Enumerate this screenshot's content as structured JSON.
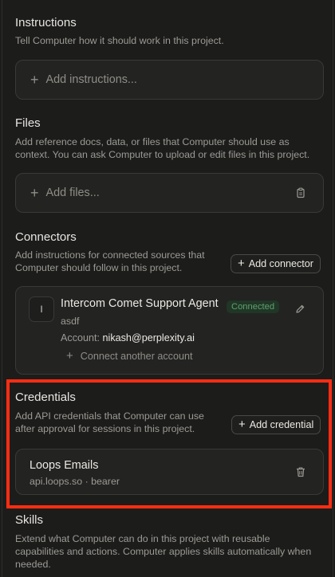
{
  "instructions": {
    "title": "Instructions",
    "description": "Tell Computer how it should work in this project.",
    "add_label": "Add instructions..."
  },
  "files": {
    "title": "Files",
    "description_line1": "Add reference docs, data, or files that Computer should use as",
    "description_line2": "context. You can ask Computer to upload or edit files in this project.",
    "add_label": "Add files..."
  },
  "connectors": {
    "title": "Connectors",
    "description_line1": "Add instructions for connected sources that",
    "description_line2": "Computer should follow in this project.",
    "add_button": "Add connector",
    "card": {
      "avatar_letter": "I",
      "name": "Intercom Comet Support Agent",
      "status": "Connected",
      "note": "asdf",
      "account_label": "Account:",
      "account_email": "nikash@perplexity.ai",
      "connect_another": "Connect another account"
    }
  },
  "credentials": {
    "title": "Credentials",
    "description_line1": "Add API credentials that Computer can use",
    "description_line2": "after approval for sessions in this project.",
    "add_button": "Add credential",
    "item": {
      "name": "Loops Emails",
      "detail": "api.loops.so · bearer"
    }
  },
  "skills": {
    "title": "Skills",
    "description_line1": "Extend what Computer can do in this project with reusable",
    "description_line2": "capabilities and actions. Computer applies skills automatically when",
    "description_line3": "needed."
  },
  "colors": {
    "background": "#1c1c1b",
    "card": "#232322",
    "connected_green": "#5fa06e",
    "highlight_red": "#ff2d12"
  }
}
